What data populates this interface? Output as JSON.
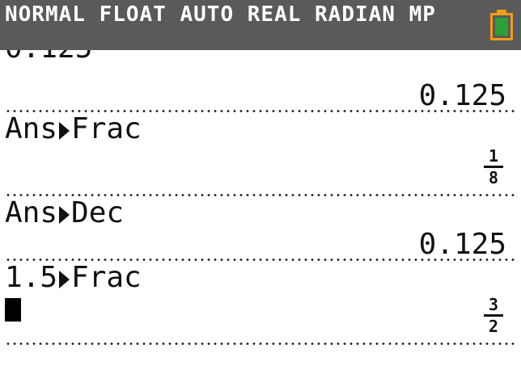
{
  "status": {
    "mode_text": "NORMAL FLOAT AUTO REAL RADIAN MP",
    "battery_color": "#f39c1a",
    "battery_fill_color": "#2e9e3a"
  },
  "history": {
    "partial_result": "0.125",
    "result_1": "0.125",
    "entry_2_prefix": "Ans",
    "entry_2_suffix": "Frac",
    "result_2_numerator": "1",
    "result_2_denominator": "8",
    "entry_3_prefix": "Ans",
    "entry_3_suffix": "Dec",
    "result_3": "0.125",
    "entry_4_prefix": "1.5",
    "entry_4_suffix": "Frac",
    "result_4_numerator": "3",
    "result_4_denominator": "2"
  }
}
